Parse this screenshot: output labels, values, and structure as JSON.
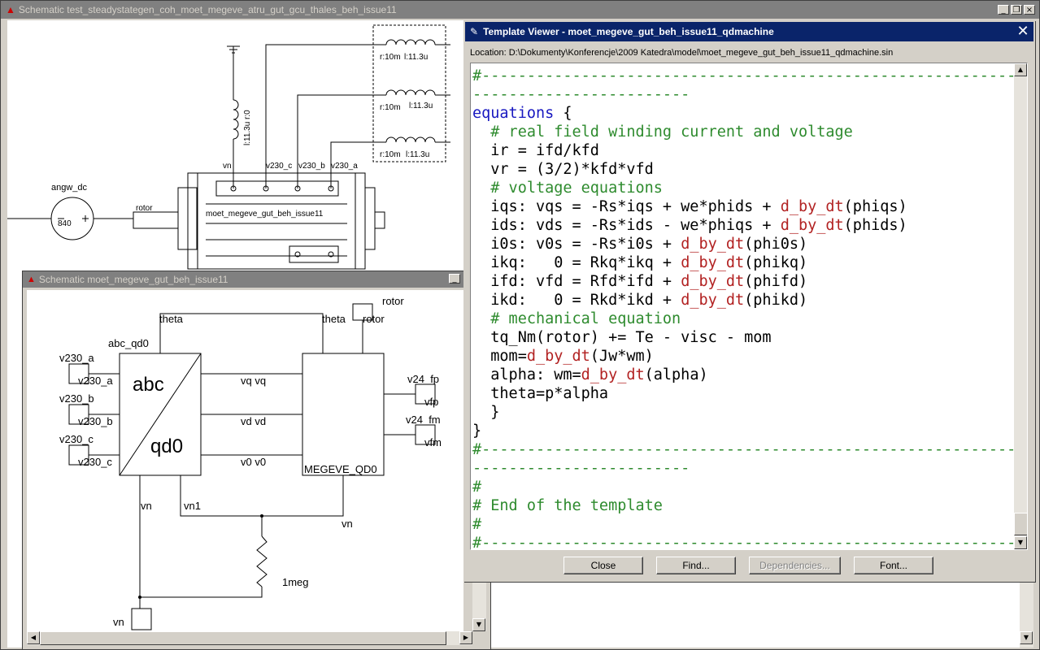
{
  "main_window": {
    "title": "Schematic test_steadystategen_coh_moet_megeve_atru_gut_gcu_thales_beh_issue11",
    "labels": {
      "angw_dc": "angw_dc",
      "rotor": "rotor",
      "source_value": "840",
      "inductor_value": "l:11.3u r:0",
      "r1": "r:10m",
      "l1": "l:11.3u",
      "r2": "r:10m",
      "l2": "l:11.3u",
      "r3": "r:10m",
      "l3": "l:11.3u",
      "vn": "vn",
      "v230_c": "v230_c",
      "v230_b": "v230_b",
      "v230_a": "v230_a",
      "machine": "moet_megeve_gut_beh_issue11"
    }
  },
  "sub_window": {
    "title": "Schematic moet_megeve_gut_beh_issue11",
    "labels": {
      "rotor_top": "rotor",
      "theta_left": "theta",
      "theta_right": "theta",
      "rotor_pin": "rotor",
      "abc_qd0": "abc_qd0",
      "v230_a": "v230_a",
      "v230_a_pin": "v230_a",
      "v230_b": "v230_b",
      "v230_b_pin": "v230_b",
      "v230_c": "v230_c",
      "v230_c_pin": "v230_c",
      "abc": "abc",
      "qd0": "qd0",
      "vq": "vq  vq",
      "vd": "vd  vd",
      "v0": "v0  v0",
      "megeve": "MEGEVE_QD0",
      "v24_fp": "v24_fp",
      "vfp": "vfp",
      "v24_fm": "v24_fm",
      "vfm": "vfm",
      "vn": "vn",
      "vn1": "vn1",
      "vn_right": "vn",
      "res": "1meg",
      "vn_bottom": "vn"
    }
  },
  "template_viewer": {
    "title": "Template Viewer - moet_megeve_gut_beh_issue11_qdmachine",
    "location": "Location: D:\\Dokumenty\\Konferencje\\2009 Katedra\\model\\moet_megeve_gut_beh_issue11_qdmachine.sin",
    "buttons": {
      "close": "Close",
      "find": "Find...",
      "dependencies": "Dependencies...",
      "font": "Font..."
    },
    "code_lines": [
      {
        "parts": [
          {
            "c": "cm",
            "t": "#-------------------------------------------------------------"
          }
        ]
      },
      {
        "parts": [
          {
            "c": "cm",
            "t": "------------------------"
          }
        ]
      },
      {
        "parts": [
          {
            "c": "kw",
            "t": "equations"
          },
          {
            "c": "",
            "t": " {"
          }
        ]
      },
      {
        "parts": [
          {
            "c": "cm",
            "t": "  # real field winding current and voltage"
          }
        ]
      },
      {
        "parts": [
          {
            "c": "",
            "t": "  ir = ifd/kfd"
          }
        ]
      },
      {
        "parts": [
          {
            "c": "",
            "t": "  vr = (3/2)*kfd*vfd"
          }
        ]
      },
      {
        "parts": [
          {
            "c": "cm",
            "t": "  # voltage equations"
          }
        ]
      },
      {
        "parts": [
          {
            "c": "",
            "t": "  iqs: vqs = -Rs*iqs + we*phids + "
          },
          {
            "c": "fn",
            "t": "d_by_dt"
          },
          {
            "c": "",
            "t": "(phiqs)"
          }
        ]
      },
      {
        "parts": [
          {
            "c": "",
            "t": "  ids: vds = -Rs*ids - we*phiqs + "
          },
          {
            "c": "fn",
            "t": "d_by_dt"
          },
          {
            "c": "",
            "t": "(phids)"
          }
        ]
      },
      {
        "parts": [
          {
            "c": "",
            "t": "  i0s: v0s = -Rs*i0s + "
          },
          {
            "c": "fn",
            "t": "d_by_dt"
          },
          {
            "c": "",
            "t": "(phi0s)"
          }
        ]
      },
      {
        "parts": [
          {
            "c": "",
            "t": "  ikq:   0 = Rkq*ikq + "
          },
          {
            "c": "fn",
            "t": "d_by_dt"
          },
          {
            "c": "",
            "t": "(phikq)"
          }
        ]
      },
      {
        "parts": [
          {
            "c": "",
            "t": "  ifd: vfd = Rfd*ifd + "
          },
          {
            "c": "fn",
            "t": "d_by_dt"
          },
          {
            "c": "",
            "t": "(phifd)"
          }
        ]
      },
      {
        "parts": [
          {
            "c": "",
            "t": "  ikd:   0 = Rkd*ikd + "
          },
          {
            "c": "fn",
            "t": "d_by_dt"
          },
          {
            "c": "",
            "t": "(phikd)"
          }
        ]
      },
      {
        "parts": [
          {
            "c": "cm",
            "t": "  # mechanical equation"
          }
        ]
      },
      {
        "parts": [
          {
            "c": "",
            "t": "  tq_Nm(rotor) += Te - visc - mom"
          }
        ]
      },
      {
        "parts": [
          {
            "c": "",
            "t": "  mom="
          },
          {
            "c": "fn",
            "t": "d_by_dt"
          },
          {
            "c": "",
            "t": "(Jw*wm)"
          }
        ]
      },
      {
        "parts": [
          {
            "c": "",
            "t": "  alpha: wm="
          },
          {
            "c": "fn",
            "t": "d_by_dt"
          },
          {
            "c": "",
            "t": "(alpha)"
          }
        ]
      },
      {
        "parts": [
          {
            "c": "",
            "t": "  theta=p*alpha"
          }
        ]
      },
      {
        "parts": [
          {
            "c": "",
            "t": "  }"
          }
        ]
      },
      {
        "parts": [
          {
            "c": "",
            "t": "}"
          }
        ]
      },
      {
        "parts": [
          {
            "c": "cm",
            "t": "#-------------------------------------------------------------"
          }
        ]
      },
      {
        "parts": [
          {
            "c": "cm",
            "t": "------------------------"
          }
        ]
      },
      {
        "parts": [
          {
            "c": "cm",
            "t": "#"
          }
        ]
      },
      {
        "parts": [
          {
            "c": "cm",
            "t": "# End of the template"
          }
        ]
      },
      {
        "parts": [
          {
            "c": "cm",
            "t": "#"
          }
        ]
      },
      {
        "parts": [
          {
            "c": "cm",
            "t": "#-------------------------------------------------------------"
          }
        ]
      }
    ]
  }
}
